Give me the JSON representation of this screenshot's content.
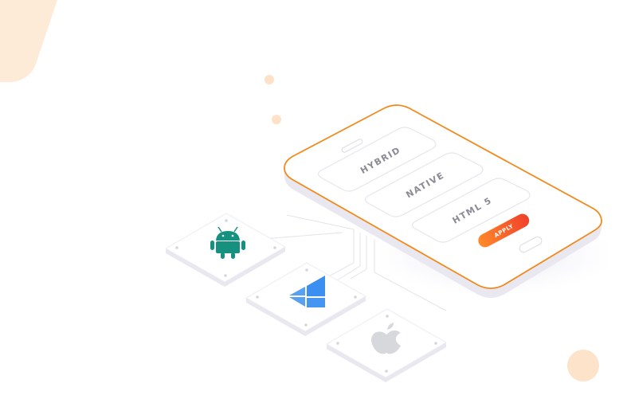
{
  "phone": {
    "options": [
      {
        "label": "HYBRID"
      },
      {
        "label": "NATIVE"
      },
      {
        "label": "HTML 5"
      }
    ],
    "apply_label": "APPLY"
  },
  "platforms": [
    {
      "icon": "android-icon",
      "color": "#16907f"
    },
    {
      "icon": "windows-icon",
      "color": "#3b8ff0"
    },
    {
      "icon": "apple-icon",
      "color": "#d6d8dc"
    }
  ],
  "colors": {
    "accent": "#f08a1c",
    "blob": "#fdebd8",
    "apply_gradient": [
      "#ff8a2a",
      "#f0402a"
    ]
  }
}
